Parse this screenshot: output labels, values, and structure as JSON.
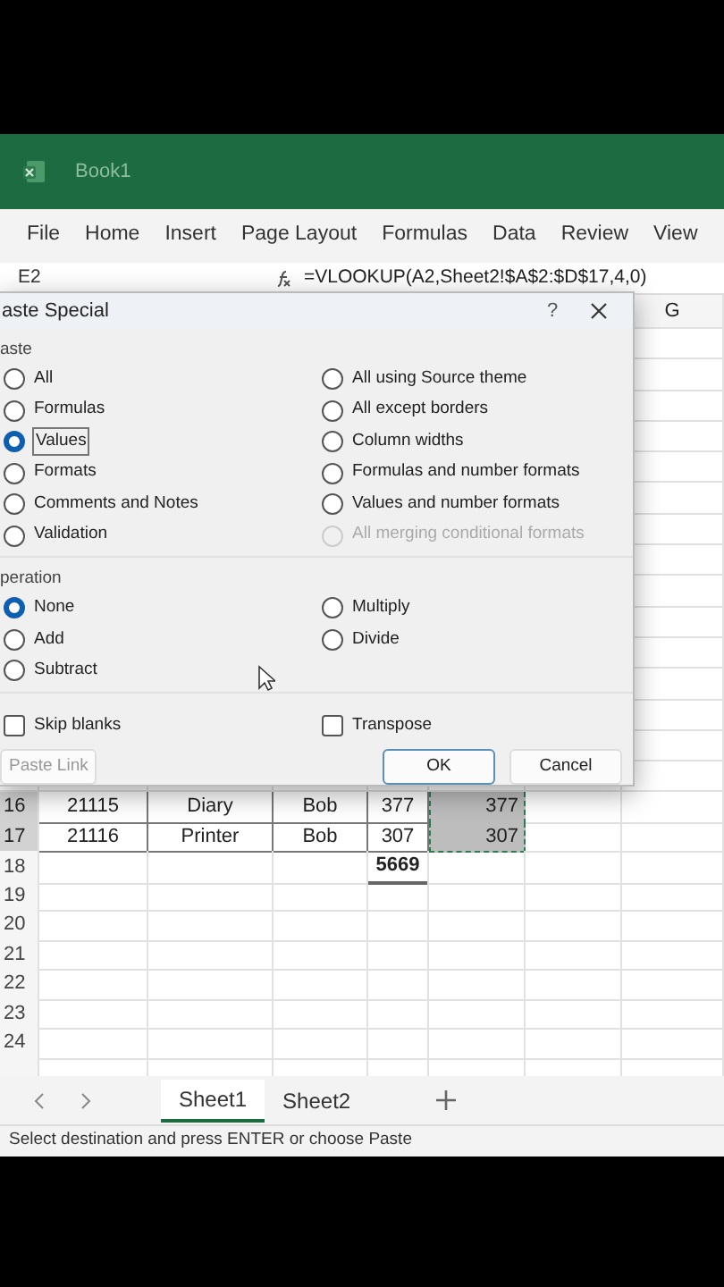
{
  "title_bar": {
    "title": "Book1"
  },
  "ribbon_tabs": [
    "File",
    "Home",
    "Insert",
    "Page Layout",
    "Formulas",
    "Data",
    "Review",
    "View"
  ],
  "formula_bar": {
    "name_box": "E2",
    "formula": "=VLOOKUP(A2,Sheet2!$A$2:$D$17,4,0)"
  },
  "grid": {
    "column_headers": [
      "G"
    ],
    "rows": [
      {
        "number": "16",
        "kind": "data",
        "selected": true,
        "cells": [
          "21115",
          "Diary",
          "Bob",
          "377",
          "377"
        ]
      },
      {
        "number": "17",
        "kind": "data",
        "selected": true,
        "cells": [
          "21116",
          "Printer",
          "Bob",
          "307",
          "307"
        ]
      },
      {
        "number": "18",
        "kind": "total",
        "selected": false,
        "total": "5669"
      },
      {
        "number": "19",
        "kind": "empty",
        "selected": false
      },
      {
        "number": "20",
        "kind": "empty",
        "selected": false
      },
      {
        "number": "21",
        "kind": "empty",
        "selected": false
      },
      {
        "number": "22",
        "kind": "empty",
        "selected": false
      },
      {
        "number": "23",
        "kind": "empty",
        "selected": false
      },
      {
        "number": "24",
        "kind": "empty",
        "selected": false
      }
    ]
  },
  "dialog": {
    "title": "aste Special",
    "help": "?",
    "paste": {
      "label": "aste",
      "options": [
        {
          "label": "All",
          "selected": false,
          "disabled": false
        },
        {
          "label": "Formulas",
          "selected": false,
          "disabled": false
        },
        {
          "label": "Values",
          "selected": true,
          "disabled": false
        },
        {
          "label": "Formats",
          "selected": false,
          "disabled": false
        },
        {
          "label": "Comments and Notes",
          "selected": false,
          "disabled": false
        },
        {
          "label": "Validation",
          "selected": false,
          "disabled": false
        },
        {
          "label": "All using Source theme",
          "selected": false,
          "disabled": false
        },
        {
          "label": "All except borders",
          "selected": false,
          "disabled": false
        },
        {
          "label": "Column widths",
          "selected": false,
          "disabled": false
        },
        {
          "label": "Formulas and number formats",
          "selected": false,
          "disabled": false
        },
        {
          "label": "Values and number formats",
          "selected": false,
          "disabled": false
        },
        {
          "label": "All merging conditional formats",
          "selected": false,
          "disabled": true
        }
      ]
    },
    "operation": {
      "label": "peration",
      "options": [
        {
          "label": "None",
          "selected": true,
          "disabled": false
        },
        {
          "label": "Add",
          "selected": false,
          "disabled": false
        },
        {
          "label": "Subtract",
          "selected": false,
          "disabled": false
        },
        {
          "label": "Multiply",
          "selected": false,
          "disabled": false
        },
        {
          "label": "Divide",
          "selected": false,
          "disabled": false
        }
      ]
    },
    "checkboxes": [
      {
        "label": "Skip blanks",
        "checked": false
      },
      {
        "label": "Transpose",
        "checked": false
      }
    ],
    "buttons": [
      {
        "label": "Paste Link",
        "kind": "link"
      },
      {
        "label": "OK",
        "kind": "default"
      },
      {
        "label": "Cancel",
        "kind": "normal"
      }
    ]
  },
  "sheet_tabs": [
    {
      "label": "Sheet1",
      "selected": true
    },
    {
      "label": "Sheet2",
      "selected": false
    }
  ],
  "status_bar": "Select destination and press ENTER or choose Paste"
}
